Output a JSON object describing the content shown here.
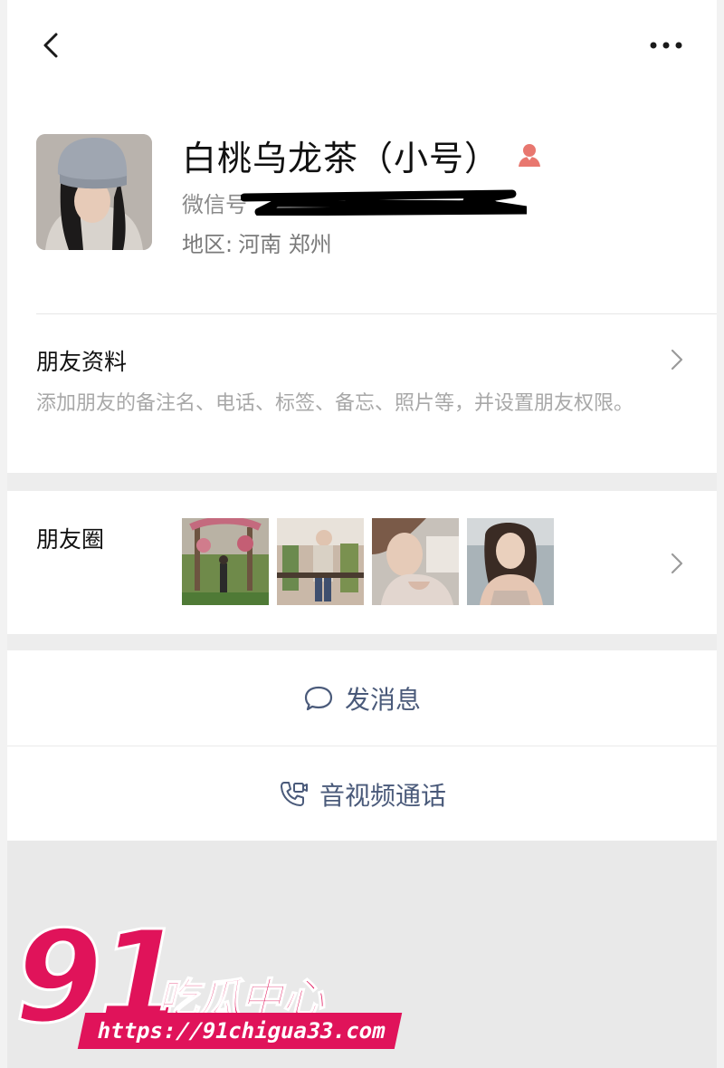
{
  "profile": {
    "name": "白桃乌龙茶（小号）",
    "wechat_id_label": "微信号",
    "region_label": "地区:",
    "region_value": "河南 郑州"
  },
  "info": {
    "title": "朋友资料",
    "description": "添加朋友的备注名、电话、标签、备忘、照片等，并设置朋友权限。"
  },
  "moments": {
    "title": "朋友圈"
  },
  "actions": {
    "message_label": "发消息",
    "call_label": "音视频通话"
  },
  "watermark": {
    "number": "91",
    "text": "吃瓜中心",
    "url": "https://91chigua33.com"
  },
  "colors": {
    "action_text": "#4a5a7a",
    "secondary_text": "#a8a8a8",
    "gender_icon": "#e8776f",
    "watermark": "#e0135a"
  },
  "icons": {
    "back": "chevron-left-icon",
    "more": "more-dots-icon",
    "gender": "female-user-icon",
    "message": "chat-bubble-icon",
    "call": "video-call-icon"
  }
}
